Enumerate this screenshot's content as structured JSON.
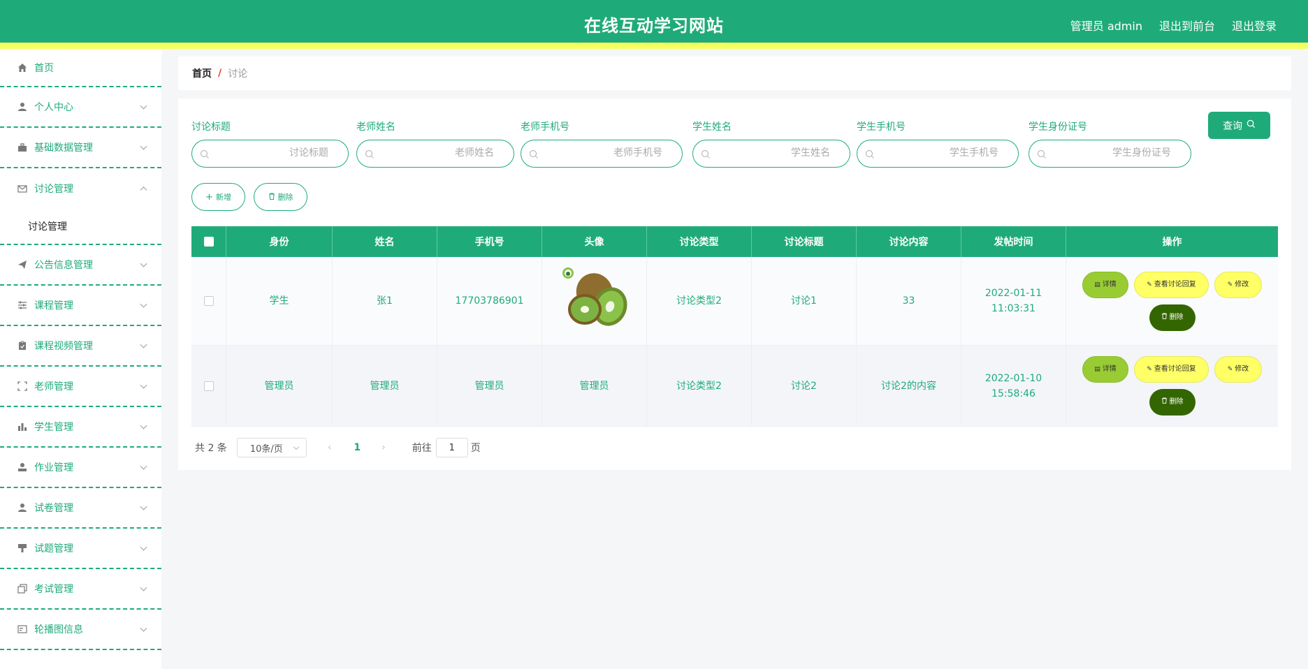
{
  "header": {
    "title": "在线互动学习网站",
    "user_label": "管理员 admin",
    "to_front": "退出到前台",
    "logout": "退出登录",
    "colors": {
      "primary": "#1fab79",
      "stripe": "#f6ff5e"
    }
  },
  "sidebar": {
    "items": [
      {
        "label": "首页",
        "icon": "home-icon"
      },
      {
        "label": "个人中心",
        "icon": "user-icon"
      },
      {
        "label": "基础数据管理",
        "icon": "suitcase-icon"
      },
      {
        "label": "讨论管理",
        "icon": "mail-icon"
      },
      {
        "label": "公告信息管理",
        "icon": "send-icon"
      },
      {
        "label": "课程管理",
        "icon": "sliders-icon"
      },
      {
        "label": "课程视频管理",
        "icon": "clipboard-icon"
      },
      {
        "label": "老师管理",
        "icon": "fullscreen-icon"
      },
      {
        "label": "学生管理",
        "icon": "bar-chart-icon"
      },
      {
        "label": "作业管理",
        "icon": "user-solid-icon"
      },
      {
        "label": "试卷管理",
        "icon": "user-icon"
      },
      {
        "label": "试题管理",
        "icon": "brush-icon"
      },
      {
        "label": "考试管理",
        "icon": "copy-icon"
      },
      {
        "label": "轮播图信息",
        "icon": "picture-icon"
      }
    ],
    "sub_item": "讨论管理"
  },
  "breadcrumb": {
    "home": "首页",
    "separator": "/",
    "current": "讨论"
  },
  "search": {
    "fields": [
      {
        "label": "讨论标题",
        "placeholder": "讨论标题"
      },
      {
        "label": "老师姓名",
        "placeholder": "老师姓名"
      },
      {
        "label": "老师手机号",
        "placeholder": "老师手机号"
      },
      {
        "label": "学生姓名",
        "placeholder": "学生姓名"
      },
      {
        "label": "学生手机号",
        "placeholder": "学生手机号"
      },
      {
        "label": "学生身份证号",
        "placeholder": "学生身份证号"
      }
    ],
    "query_label": "查询"
  },
  "actions": {
    "add_label": "新增",
    "delete_label": "删除"
  },
  "table": {
    "columns": [
      "身份",
      "姓名",
      "手机号",
      "头像",
      "讨论类型",
      "讨论标题",
      "讨论内容",
      "发帖时间",
      "操作"
    ],
    "rows": [
      {
        "role": "学生",
        "name": "张1",
        "phone": "17703786901",
        "avatar": "",
        "type": "讨论类型2",
        "title": "讨论1",
        "content": "33",
        "time": "2022-01-11 11:03:31"
      },
      {
        "role": "管理员",
        "name": "管理员",
        "phone": "管理员",
        "avatar": "管理员",
        "type": "讨论类型2",
        "title": "讨论2",
        "content": "讨论2的内容",
        "time": "2022-01-10 15:58:46"
      }
    ],
    "ops": {
      "detail": "详情",
      "reply": "查看讨论回复",
      "edit": "修改",
      "delete": "删除"
    }
  },
  "pagination": {
    "total": "共 2 条",
    "page_size": "10条/页",
    "current_page": "1",
    "goto_label": "前往",
    "goto_value": "1",
    "page_suffix": "页"
  }
}
